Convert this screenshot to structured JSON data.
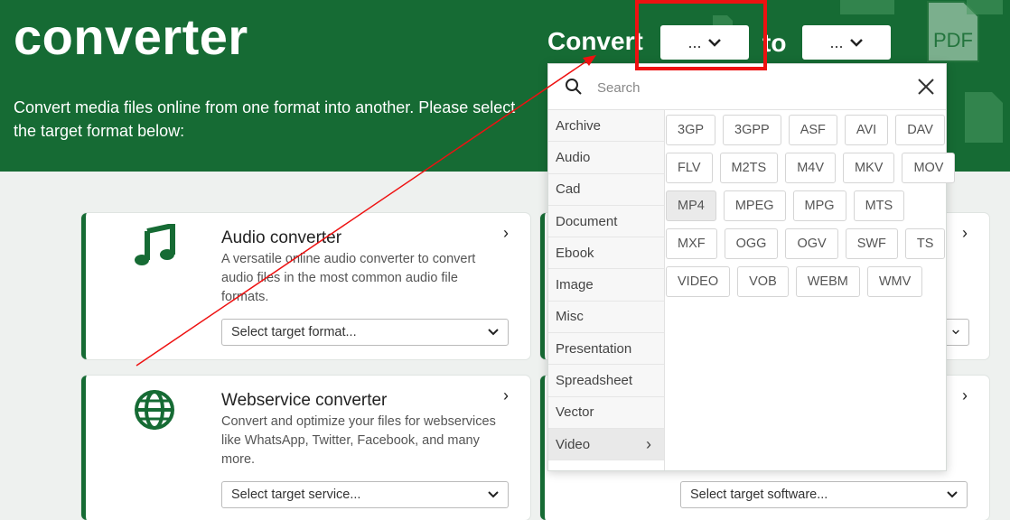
{
  "hero": {
    "title": "converter",
    "description": "Convert media files online from one format into another. Please select the target format below:",
    "convert_label": "Convert",
    "to_label": "to",
    "from_button": "...",
    "to_button": "..."
  },
  "dropdown": {
    "search_placeholder": "Search",
    "categories": [
      "Archive",
      "Audio",
      "Cad",
      "Document",
      "Ebook",
      "Image",
      "Misc",
      "Presentation",
      "Spreadsheet",
      "Vector",
      "Video"
    ],
    "active_category": "Video",
    "formats": [
      [
        "3GP",
        "3GPP",
        "ASF",
        "AVI",
        "DAV"
      ],
      [
        "FLV",
        "M2TS",
        "M4V",
        "MKV",
        "MOV"
      ],
      [
        "MP4",
        "MPEG",
        "MPG",
        "MTS"
      ],
      [
        "MXF",
        "OGG",
        "OGV",
        "SWF",
        "TS"
      ],
      [
        "VIDEO",
        "VOB",
        "WEBM",
        "WMV"
      ]
    ],
    "highlighted_format": "MP4"
  },
  "cards": {
    "audio": {
      "title": "Audio converter",
      "description": "A versatile online audio converter to convert audio files in the most common audio file formats.",
      "select_value": "Select target format..."
    },
    "webservice": {
      "title": "Webservice converter",
      "description": "Convert and optimize your files for webservices like WhatsApp, Twitter, Facebook, and many more.",
      "select_value": "Select target service..."
    },
    "software": {
      "select_value": "Select target software..."
    }
  },
  "colors": {
    "brand_green": "#166b34",
    "annotation_red": "#e11111"
  }
}
